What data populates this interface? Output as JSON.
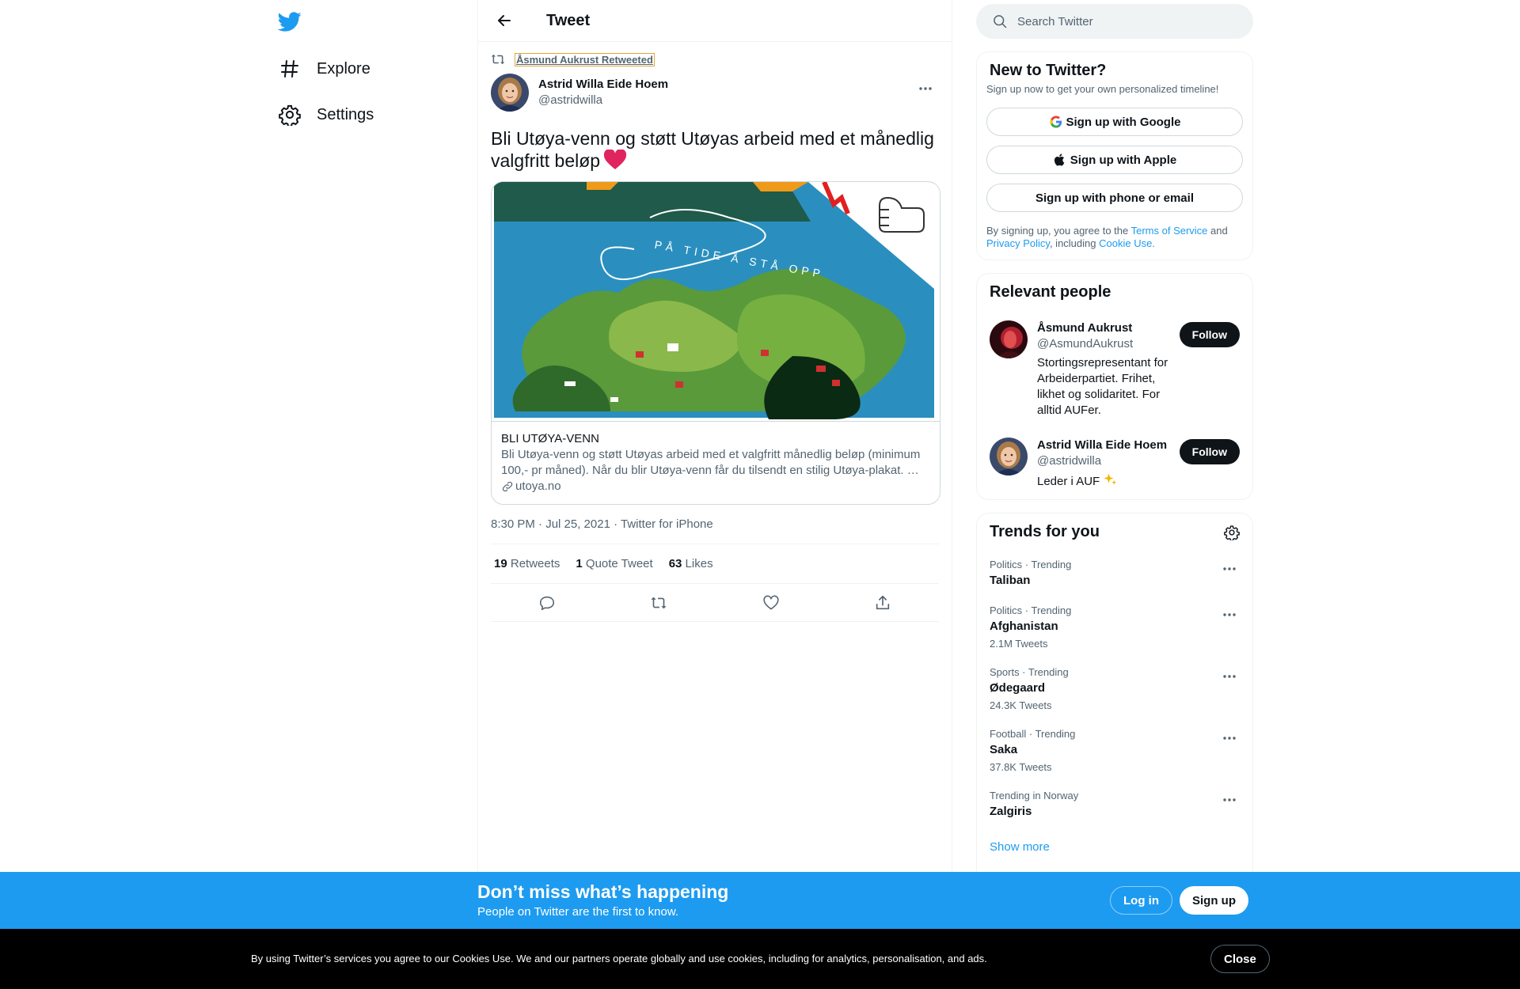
{
  "nav": {
    "explore_label": "Explore",
    "settings_label": "Settings"
  },
  "header": {
    "title": "Tweet"
  },
  "tweet": {
    "social_context": "Åsmund Aukrust Retweeted",
    "author_name": "Astrid Willa Eide Hoem",
    "author_handle": "@astridwilla",
    "text": "Bli Utøya-venn og støtt Utøyas arbeid med et månedlig valgfritt beløp",
    "card": {
      "image_text": "PÅ TIDE Å STÅ OPP",
      "title": "BLI UTØYA-VENN",
      "description": "Bli Utøya-venn og støtt Utøyas arbeid med et valgfritt månedlig beløp (minimum 100,- pr måned). Når du blir Utøya-venn får du tilsendt en stilig Utøya-plakat. …",
      "url": "utoya.no"
    },
    "timestamp": "8:30 PM · Jul 25, 2021",
    "source": " · Twitter for iPhone",
    "stats": {
      "retweets_count": "19",
      "retweets_label": "Retweets",
      "quotes_count": "1",
      "quotes_label": "Quote Tweet",
      "likes_count": "63",
      "likes_label": "Likes"
    }
  },
  "search": {
    "placeholder": "Search Twitter"
  },
  "new_to_twitter": {
    "title": "New to Twitter?",
    "subtitle": "Sign up now to get your own personalized timeline!",
    "google_label": "Sign up with Google",
    "apple_label": "Sign up with Apple",
    "phone_label": "Sign up with phone or email",
    "legal_prefix": "By signing up, you agree to the ",
    "terms": "Terms of Service",
    "and": " and ",
    "privacy": "Privacy Policy",
    "including": ", including ",
    "cookie": "Cookie Use."
  },
  "relevant": {
    "title": "Relevant people",
    "people": [
      {
        "name": "Åsmund Aukrust",
        "handle": "@AsmundAukrust",
        "bio": "Stortingsrepresentant for Arbeiderpartiet. Frihet, likhet og solidaritet. For alltid AUFer.",
        "follow_label": "Follow"
      },
      {
        "name": "Astrid Willa Eide Hoem",
        "handle": "@astridwilla",
        "bio": "Leder i AUF",
        "follow_label": "Follow"
      }
    ]
  },
  "trends": {
    "title": "Trends for you",
    "items": [
      {
        "meta": "Politics · Trending",
        "name": "Taliban",
        "count": ""
      },
      {
        "meta": "Politics · Trending",
        "name": "Afghanistan",
        "count": "2.1M Tweets"
      },
      {
        "meta": "Sports · Trending",
        "name": "Ødegaard",
        "count": "24.3K Tweets"
      },
      {
        "meta": "Football · Trending",
        "name": "Saka",
        "count": "37.8K Tweets"
      },
      {
        "meta": "Trending in Norway",
        "name": "Zalgiris",
        "count": ""
      }
    ],
    "show_more": "Show more"
  },
  "bottom_bar": {
    "title": "Don’t miss what’s happening",
    "subtitle": "People on Twitter are the first to know.",
    "login_label": "Log in",
    "signup_label": "Sign up"
  },
  "cookie_bar": {
    "text": "By using Twitter’s services you agree to our Cookies Use. We and our partners operate globally and use cookies, including for analytics, personalisation, and ads.",
    "close_label": "Close"
  },
  "colors": {
    "brand_blue": "#1d9bf0",
    "text_primary": "#0f1419",
    "text_secondary": "#536471",
    "heart_red": "#e0245e"
  }
}
